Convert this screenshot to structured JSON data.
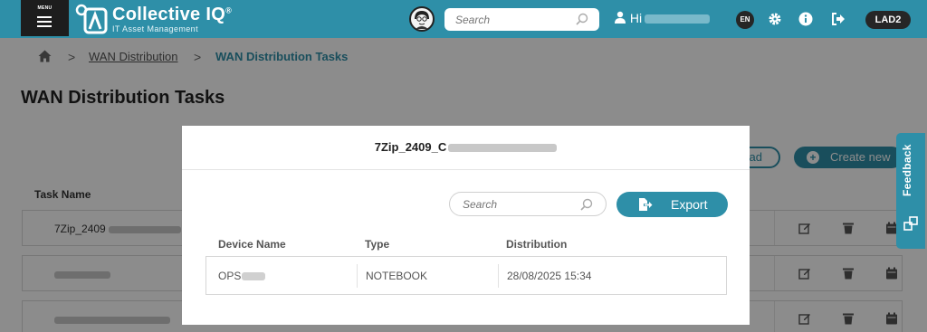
{
  "header": {
    "menu_label": "MENU",
    "app_name": "Collective IQ",
    "registered_mark": "®",
    "app_subtitle": "IT Asset Management",
    "search_placeholder": "Search",
    "greeting": "Hi",
    "language": "EN",
    "environment": "LAD2"
  },
  "breadcrumb": {
    "items": [
      "WAN Distribution",
      "WAN Distribution Tasks"
    ],
    "separator": ">"
  },
  "page": {
    "title": "WAN Distribution Tasks",
    "load_button_label": "ad",
    "create_button_label": "Create new",
    "column_header": "Task Name",
    "tasks": [
      {
        "name": "7Zip_2409"
      },
      {
        "name": ""
      },
      {
        "name": ""
      }
    ],
    "feedback_label": "Feedback"
  },
  "modal": {
    "title": "7Zip_2409_C",
    "search_placeholder": "Search",
    "export_label": "Export",
    "columns": [
      "Device Name",
      "Type",
      "Distribution"
    ],
    "rows": [
      {
        "device_name": "OPS",
        "type": "NOTEBOOK",
        "distribution": "28/08/2025 15:34"
      }
    ]
  },
  "colors": {
    "brand": "#2e8fa8",
    "dark": "#1d1d1d"
  }
}
